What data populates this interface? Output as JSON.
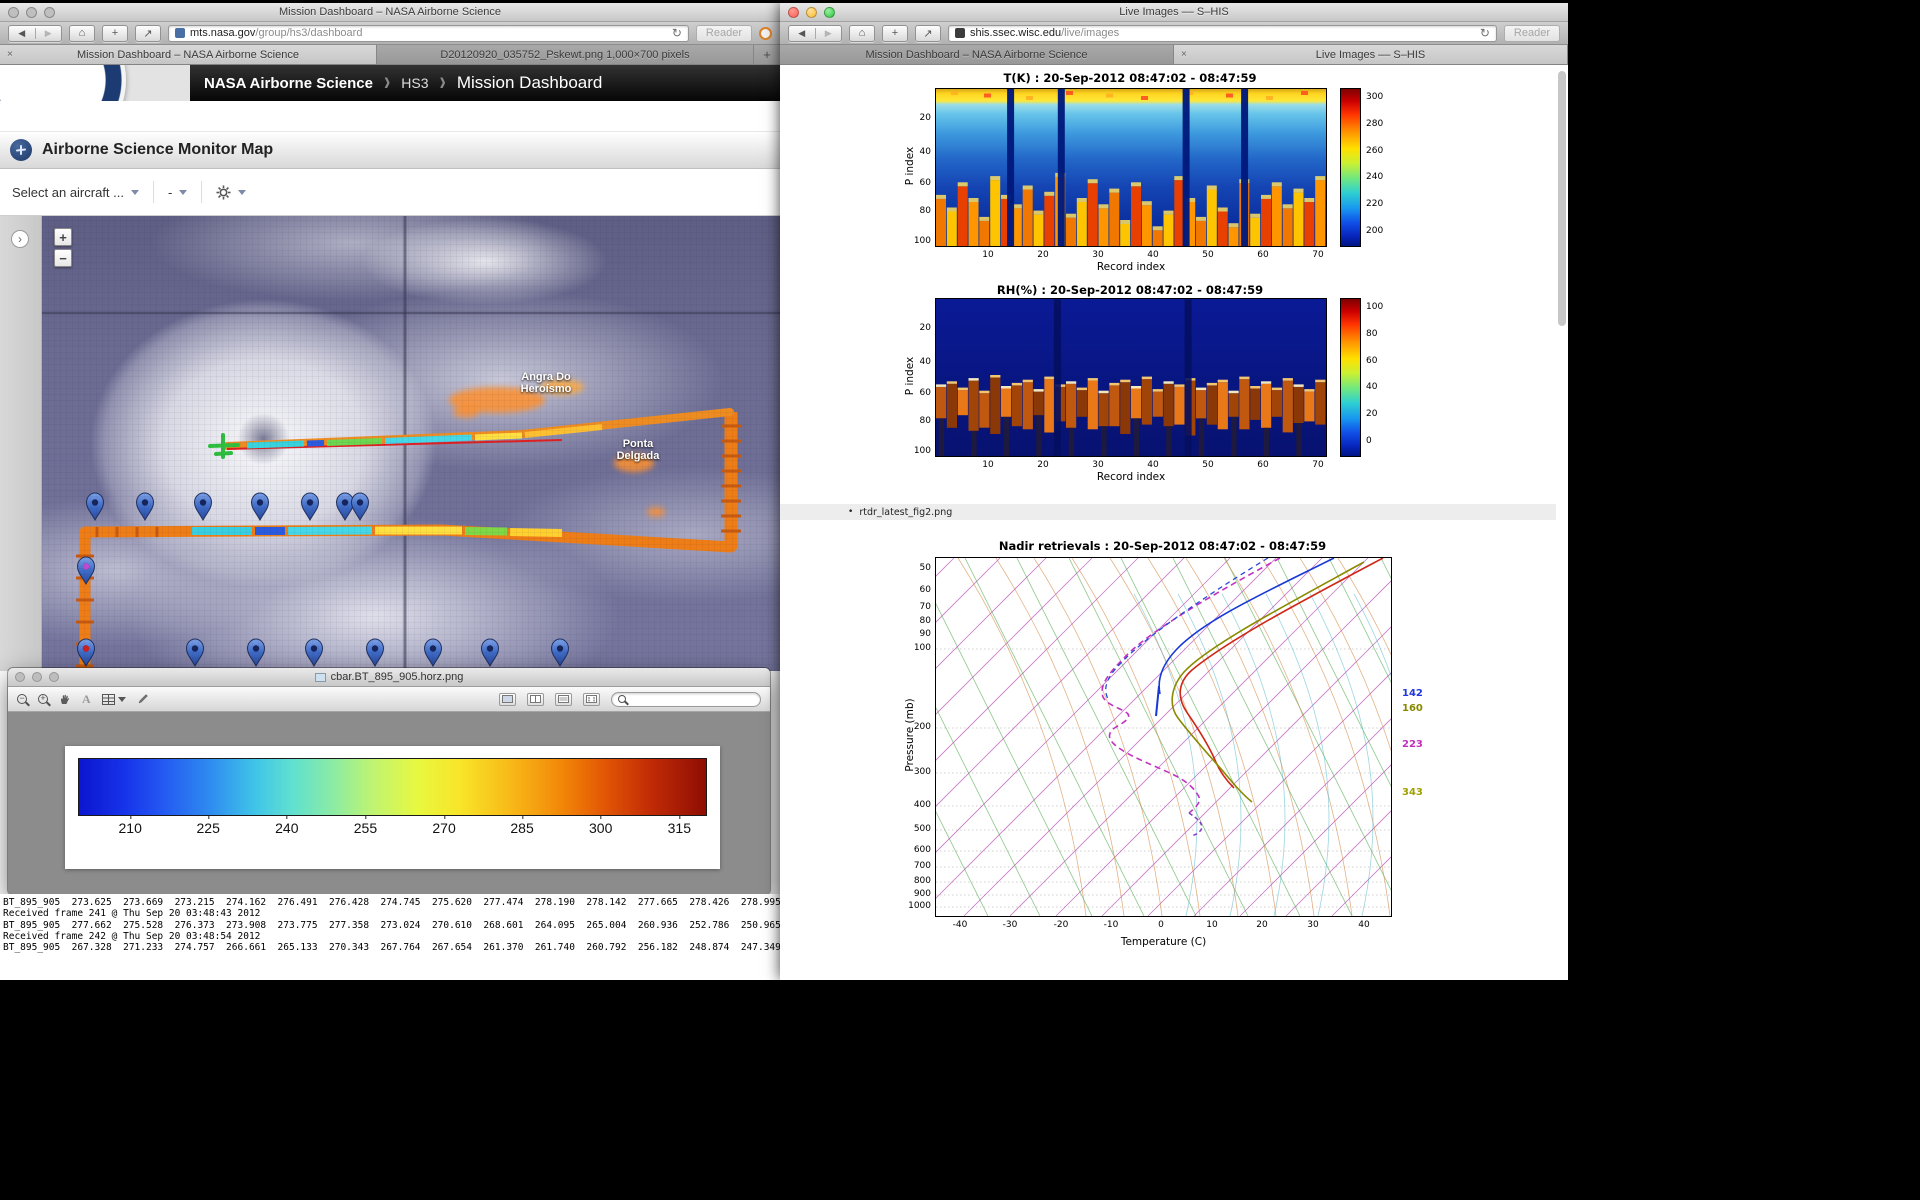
{
  "glyphs": {
    "back": "◀",
    "forward": "▶",
    "home": "⌂",
    "plus": "+",
    "share": "↗",
    "reload": "↻",
    "close": "×",
    "chev": "›",
    "bullet": "•",
    "zoom_in": "+",
    "zoom_out": "−"
  },
  "left_window": {
    "title": "Mission Dashboard – NASA Airborne Science",
    "url_domain": "mts.nasa.gov",
    "url_path": "/group/hs3/dashboard",
    "reader": "Reader",
    "tabs": [
      {
        "label": "Mission Dashboard – NASA Airborne Science"
      },
      {
        "label": "D20120920_035752_Pskewt.png 1,000×700 pixels"
      }
    ],
    "breadcrumb": {
      "brand": "NASA Airborne Science",
      "mission": "HS3",
      "page": "Mission Dashboard"
    },
    "monitor_title": "Airborne Science Monitor Map",
    "widget_toolbar": {
      "aircraft": "Select an aircraft ...",
      "layer": "-"
    },
    "map": {
      "zoom_in": "+",
      "zoom_out": "−",
      "expand": "›",
      "place1": [
        "Angra Do",
        "Heroísmo"
      ],
      "place2": [
        "Ponta",
        "Delgada"
      ]
    },
    "viewer": {
      "title": "cbar.BT_895_905.horz.png",
      "tool_text": "A",
      "colorbar_ticks": [
        "210",
        "225",
        "240",
        "255",
        "270",
        "285",
        "300",
        "315"
      ]
    },
    "console_lines": [
      "BT_895_905  273.625  273.669  273.215  274.162  276.491  276.428  274.745  275.620  277.474  278.190  278.142  277.665  278.426  278.995",
      "Received frame 241 @ Thu Sep 20 03:48:43 2012",
      "BT_895_905  277.662  275.528  276.373  273.908  273.775  277.358  273.024  270.610  268.601  264.095  265.004  260.936  252.786  250.965",
      "Received frame 242 @ Thu Sep 20 03:48:54 2012",
      "BT_895_905  267.328  271.233  274.757  266.661  265.133  270.343  267.764  267.654  261.370  261.740  260.792  256.182  248.874  247.349"
    ]
  },
  "right_window": {
    "title": "Live Images –– S–HIS",
    "url_domain": "shis.ssec.wisc.edu",
    "url_path": "/live/images",
    "reader": "Reader",
    "tabs": [
      {
        "label": "Mission Dashboard – NASA Airborne Science"
      },
      {
        "label": "Live Images –– S–HIS"
      }
    ],
    "list_item": "rtdr_latest_fig2.png"
  },
  "chart_data": [
    {
      "type": "heatmap",
      "title": "T(K) : 20-Sep-2012 08:47:02 - 08:47:59",
      "xlabel": "Record index",
      "ylabel": "P index",
      "xticks": [
        "10",
        "20",
        "30",
        "40",
        "50",
        "60",
        "70"
      ],
      "yticks": [
        "20",
        "40",
        "60",
        "80",
        "100"
      ],
      "colorbar_ticks": [
        "300",
        "280",
        "260",
        "240",
        "220",
        "200"
      ],
      "colormap": "jet",
      "value_range": [
        200,
        300
      ],
      "columns": [
        0.3,
        0.22,
        0.38,
        0.28,
        0.16,
        0.42,
        0.3,
        0.24,
        0.36,
        0.2,
        0.32,
        0.44,
        0.18,
        0.28,
        0.4,
        0.24,
        0.34,
        0.14,
        0.38,
        0.26,
        0.1,
        0.2,
        0.42,
        0.28,
        0.16,
        0.36,
        0.22,
        0.12,
        0.4,
        0.18,
        0.3,
        0.38,
        0.24,
        0.34,
        0.28,
        0.42
      ],
      "dropouts": [
        0.19,
        0.32,
        0.64,
        0.79
      ]
    },
    {
      "type": "heatmap",
      "title": "RH(%) : 20-Sep-2012 08:47:02 - 08:47:59",
      "xlabel": "Record index",
      "ylabel": "P index",
      "xticks": [
        "10",
        "20",
        "30",
        "40",
        "50",
        "60",
        "70"
      ],
      "yticks": [
        "20",
        "40",
        "60",
        "80",
        "100"
      ],
      "colorbar_ticks": [
        "100",
        "80",
        "60",
        "40",
        "20",
        "0"
      ],
      "colormap": "jet",
      "value_range": [
        0,
        100
      ],
      "band_tops": [
        0.56,
        0.54,
        0.58,
        0.52,
        0.6,
        0.5,
        0.57,
        0.55,
        0.53,
        0.59,
        0.51,
        0.56,
        0.54,
        0.58,
        0.52,
        0.6,
        0.55,
        0.53,
        0.57,
        0.51,
        0.59,
        0.54,
        0.56,
        0.52,
        0.58,
        0.55,
        0.53,
        0.6,
        0.51,
        0.57,
        0.54,
        0.58,
        0.52,
        0.56,
        0.59,
        0.53
      ],
      "band_lens": [
        0.2,
        0.28,
        0.16,
        0.32,
        0.22,
        0.36,
        0.18,
        0.26,
        0.3,
        0.15,
        0.34,
        0.22,
        0.28,
        0.17,
        0.31,
        0.21,
        0.26,
        0.33,
        0.19,
        0.29,
        0.16,
        0.27,
        0.24,
        0.35,
        0.18,
        0.25,
        0.3,
        0.15,
        0.32,
        0.2,
        0.28,
        0.17,
        0.33,
        0.23,
        0.19,
        0.27
      ],
      "dropouts": [
        0.31,
        0.645
      ]
    },
    {
      "type": "line",
      "title": "Nadir retrievals : 20-Sep-2012 08:47:02 - 08:47:59",
      "xlabel": "Temperature (C)",
      "ylabel": "Pressure (mb)",
      "xticks": [
        "-40",
        "-30",
        "-20",
        "-10",
        "0",
        "10",
        "20",
        "30",
        "40"
      ],
      "yticks": [
        "50",
        "60",
        "70",
        "80",
        "90",
        "100",
        "200",
        "300",
        "400",
        "500",
        "600",
        "700",
        "800",
        "900",
        "1000"
      ],
      "grid": "skew-T log-p background (isotherms, adiabats)",
      "legend": [
        {
          "label": "142",
          "color": "#2038e0"
        },
        {
          "label": "160",
          "color": "#8a8a00"
        },
        {
          "label": "223",
          "color": "#c030c0"
        },
        {
          "label": "343",
          "color": "#a0a000"
        }
      ]
    }
  ]
}
